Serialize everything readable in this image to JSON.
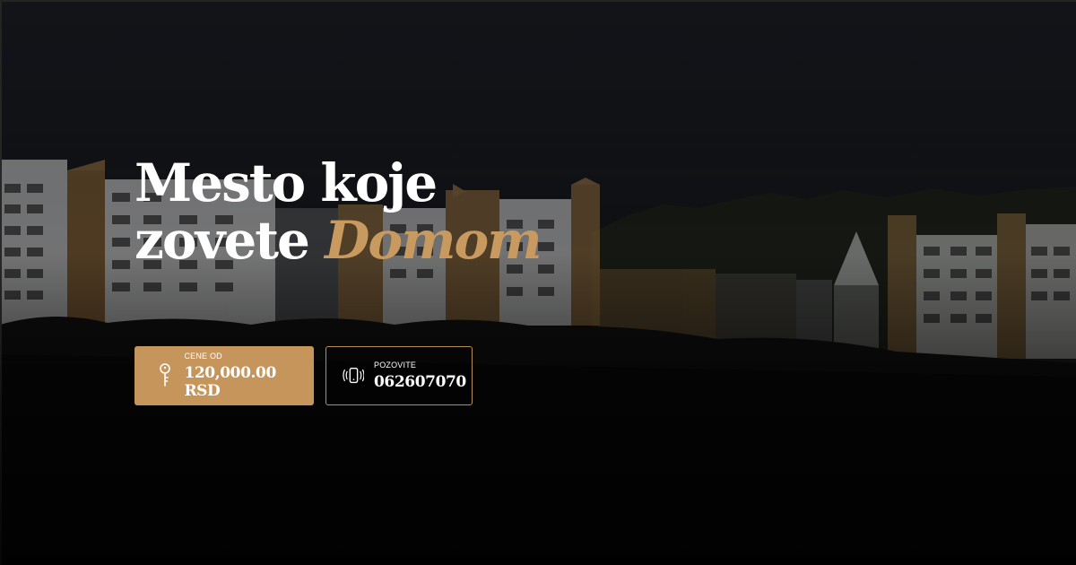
{
  "hero": {
    "title_line1": "Mesto koje",
    "title_line2": "zovete",
    "title_accent": "Domom"
  },
  "price_button": {
    "label": "CENE OD",
    "value": "120,000.00 RSD",
    "icon": "key-icon"
  },
  "call_button": {
    "label": "POZOVITE",
    "value": "062607070",
    "icon": "phone-vibrate-icon"
  },
  "colors": {
    "accent": "#c89a5f",
    "button_fill": "#c6955b",
    "background": "#070707",
    "text": "#ffffff"
  }
}
